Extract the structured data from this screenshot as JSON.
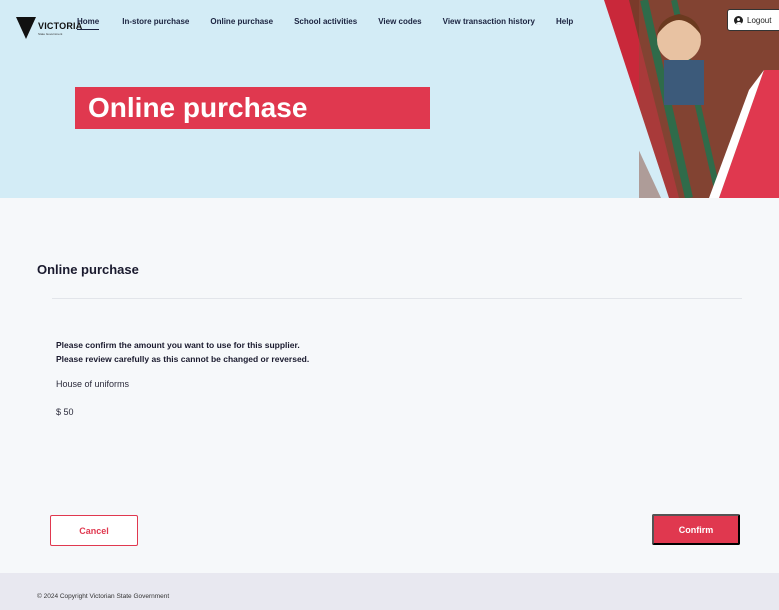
{
  "brand": {
    "logo_text": "VICTORIA",
    "logo_subtext": "State Government",
    "icon": "victoria-triangle-icon"
  },
  "nav": {
    "items": [
      {
        "label": "Home",
        "active": true
      },
      {
        "label": "In-store purchase",
        "active": false
      },
      {
        "label": "Online purchase",
        "active": false
      },
      {
        "label": "School activities",
        "active": false
      },
      {
        "label": "View codes",
        "active": false
      },
      {
        "label": "View transaction history",
        "active": false
      },
      {
        "label": "Help",
        "active": false
      }
    ],
    "logout_label": "Logout",
    "logout_icon": "user-circle-icon"
  },
  "hero": {
    "title": "Online purchase"
  },
  "main": {
    "section_title": "Online purchase",
    "confirm_lines": [
      "Please confirm the amount you want to use for this supplier.",
      "Please review carefully as this cannot be changed or reversed."
    ],
    "supplier": "House of uniforms",
    "amount": "$ 50",
    "cancel_label": "Cancel",
    "confirm_label": "Confirm"
  },
  "footer": {
    "copyright": "© 2024 Copyright Victorian State Government"
  },
  "colors": {
    "accent": "#e0384f",
    "hero_bg": "#d3ecf6",
    "nav_text": "#1b2340",
    "page_bg": "#f6f8fa",
    "footer_bg": "#e8e8f0"
  }
}
